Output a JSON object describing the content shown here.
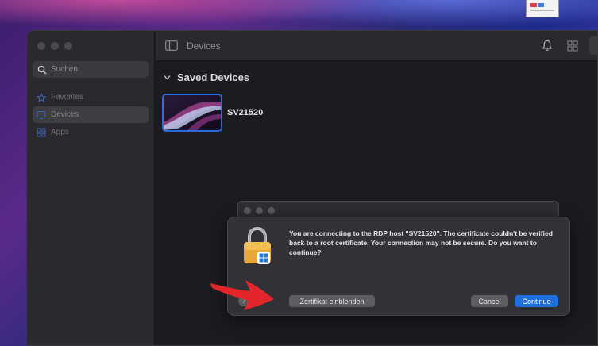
{
  "sidebar": {
    "search": {
      "placeholder": "Suchen"
    },
    "items": [
      {
        "label": "Favorites",
        "icon": "star-icon",
        "active": false
      },
      {
        "label": "Devices",
        "icon": "monitor-icon",
        "active": true
      },
      {
        "label": "Apps",
        "icon": "apps-grid-icon",
        "active": false
      }
    ]
  },
  "toolbar": {
    "title": "Devices"
  },
  "main": {
    "section_title": "Saved Devices",
    "device": {
      "name": "SV21520"
    }
  },
  "dialog": {
    "message": "You are connecting to the RDP host \"SV21520\". The certificate couldn't be verified back to a root certificate. Your connection may not be secure. Do you want to continue?",
    "help_label": "?",
    "show_certificate_label": "Zertifikat einblenden",
    "cancel_label": "Cancel",
    "continue_label": "Continue"
  },
  "colors": {
    "accent": "#1f6fe0",
    "annotation_arrow": "#e3262b",
    "device_border": "#2f6bd6"
  }
}
